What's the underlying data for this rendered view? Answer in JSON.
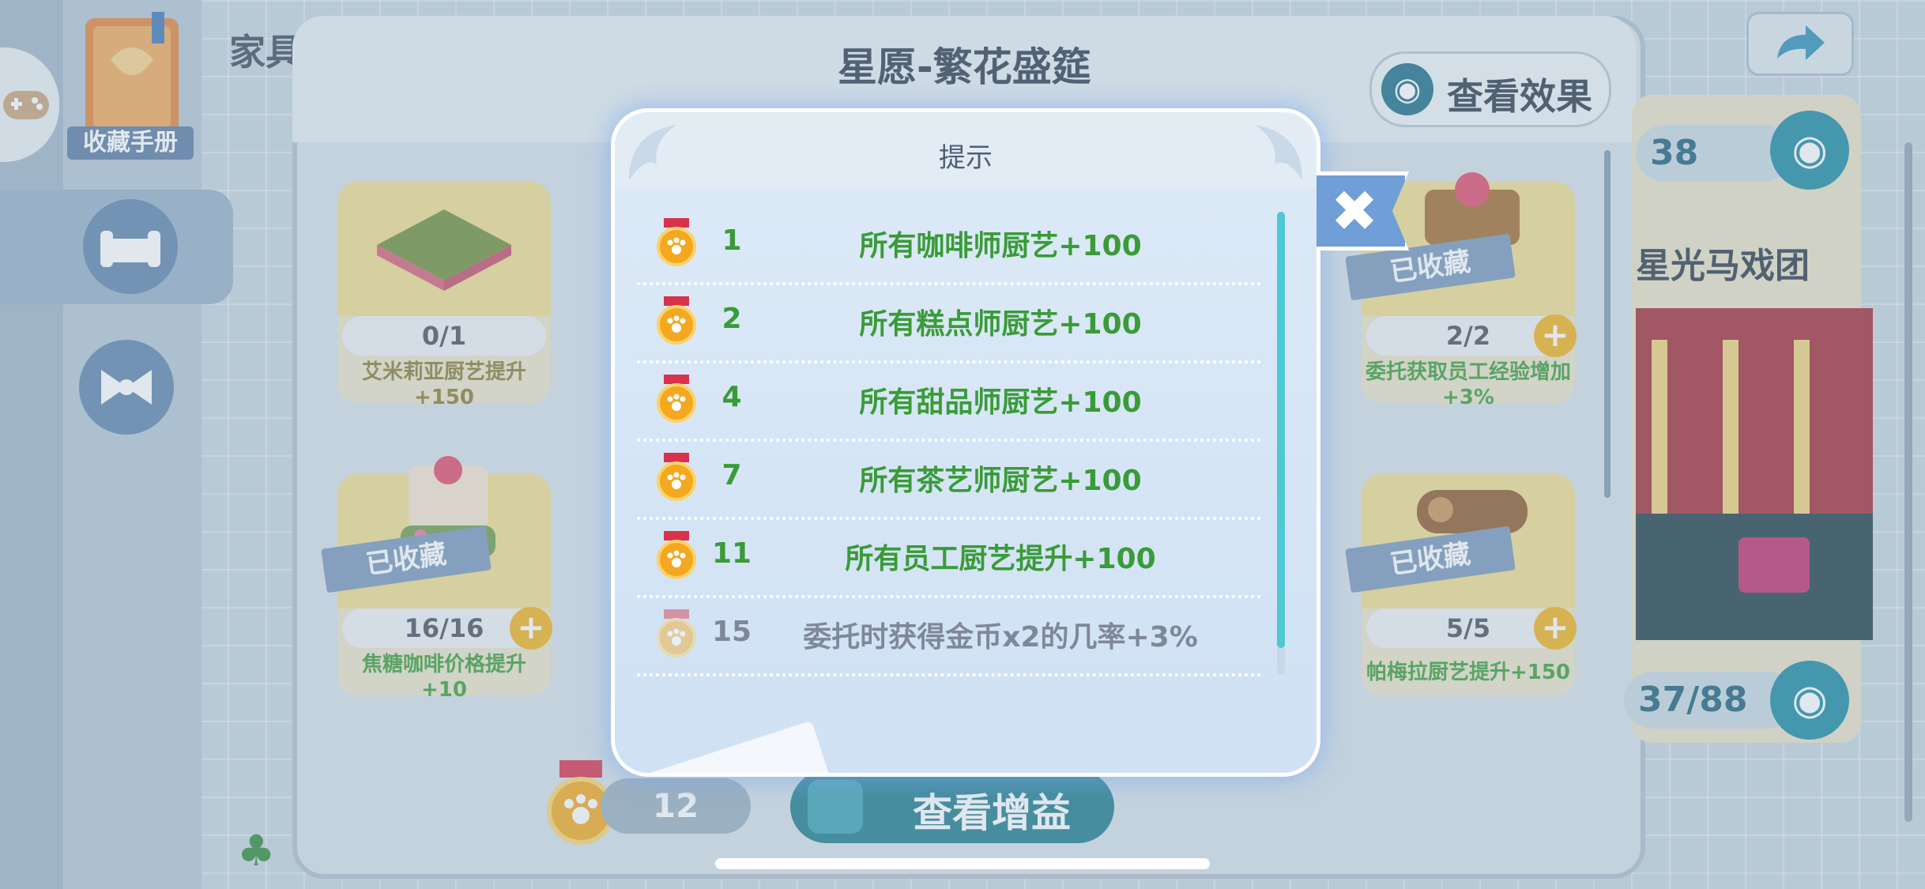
{
  "background": {
    "sidebar": {
      "collection_book_label": "收藏手册"
    },
    "top_left_title": "家具",
    "panel": {
      "title": "星愿-繁花盛筵",
      "view_effect_label": "查看效果"
    },
    "cards": [
      {
        "progress": "0/1",
        "desc": "艾米莉亚厨艺提升+150",
        "collected": ""
      },
      {
        "progress": "2/2",
        "desc": "委托获取员工经验增加+3%",
        "collected": "已收藏"
      },
      {
        "progress": "16/16",
        "desc": "焦糖咖啡价格提升+10",
        "collected": "已收藏"
      },
      {
        "progress": "5/5",
        "desc": "帕梅拉厨艺提升+150",
        "collected": "已收藏"
      }
    ],
    "right_panel": {
      "top_counter": "38",
      "title": "星光马戏团",
      "counter": "37/88"
    },
    "medal_count": "12",
    "view_buff_label": "查看增益"
  },
  "dialog": {
    "title": "提示",
    "rows": [
      {
        "level": "1",
        "text": "所有咖啡师厨艺+100",
        "unlocked": true
      },
      {
        "level": "2",
        "text": "所有糕点师厨艺+100",
        "unlocked": true
      },
      {
        "level": "4",
        "text": "所有甜品师厨艺+100",
        "unlocked": true
      },
      {
        "level": "7",
        "text": "所有茶艺师厨艺+100",
        "unlocked": true
      },
      {
        "level": "11",
        "text": "所有员工厨艺提升+100",
        "unlocked": true
      },
      {
        "level": "15",
        "text": "委托时获得金币x2的几率+3%",
        "unlocked": false
      }
    ],
    "close_icon": "close-icon"
  },
  "colors": {
    "unlocked_text": "#3a9b38",
    "locked_text": "#7f8898",
    "accent_teal": "#1c7b8c",
    "dialog_glow": "#78aaf0"
  }
}
